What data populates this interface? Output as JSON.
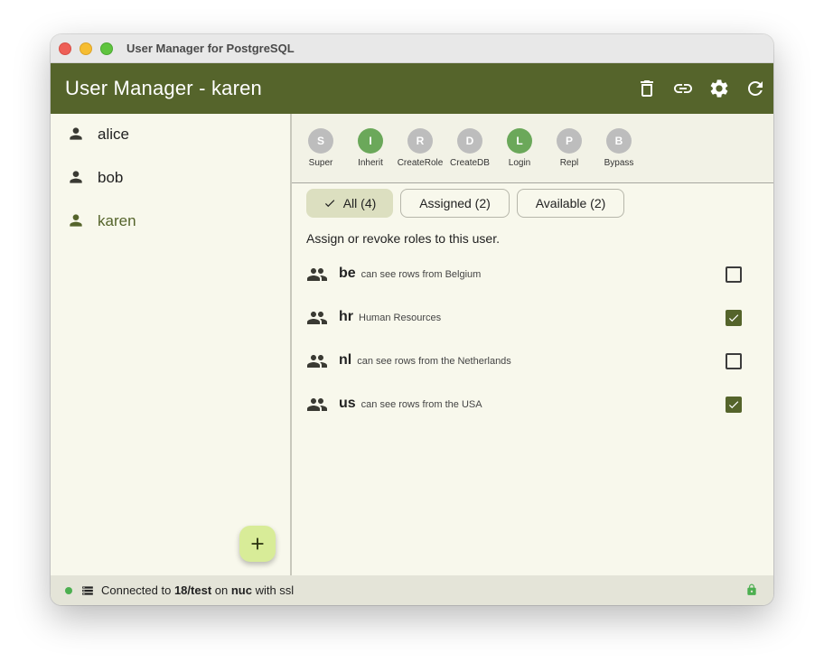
{
  "window": {
    "title": "User Manager for PostgreSQL"
  },
  "appbar": {
    "title": "User Manager - karen",
    "icons": [
      "delete-icon",
      "link-icon",
      "settings-icon",
      "refresh-icon"
    ]
  },
  "sidebar": {
    "users": [
      {
        "name": "alice",
        "selected": false
      },
      {
        "name": "bob",
        "selected": false
      },
      {
        "name": "karen",
        "selected": true
      }
    ],
    "add_icon": "add-icon"
  },
  "attributes": [
    {
      "letter": "S",
      "label": "Super",
      "enabled": false
    },
    {
      "letter": "I",
      "label": "Inherit",
      "enabled": true
    },
    {
      "letter": "R",
      "label": "CreateRole",
      "enabled": false
    },
    {
      "letter": "D",
      "label": "CreateDB",
      "enabled": false
    },
    {
      "letter": "L",
      "label": "Login",
      "enabled": true
    },
    {
      "letter": "P",
      "label": "Repl",
      "enabled": false
    },
    {
      "letter": "B",
      "label": "Bypass",
      "enabled": false
    }
  ],
  "filters": [
    {
      "label": "All (4)",
      "selected": true
    },
    {
      "label": "Assigned (2)",
      "selected": false
    },
    {
      "label": "Available (2)",
      "selected": false
    }
  ],
  "hint": "Assign or revoke roles to this user.",
  "roles": [
    {
      "name": "be",
      "description": "can see rows from Belgium",
      "assigned": false
    },
    {
      "name": "hr",
      "description": "Human Resources",
      "assigned": true
    },
    {
      "name": "nl",
      "description": "can see rows from the Netherlands",
      "assigned": false
    },
    {
      "name": "us",
      "description": "can see rows from the USA",
      "assigned": true
    }
  ],
  "status": {
    "prefix": "Connected to ",
    "database": "18/test",
    "on": " on ",
    "host": "nuc",
    "suffix": " with ssl",
    "connected_color": "#4caf50"
  },
  "colors": {
    "primary": "#55642b",
    "background": "#f8f8ec",
    "attr_on": "#6ba85a",
    "attr_off": "#bdbdbd",
    "fab": "#d8ec98"
  }
}
